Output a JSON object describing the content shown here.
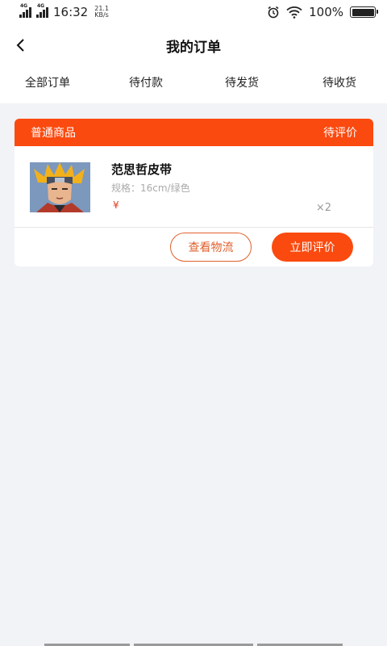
{
  "status_bar": {
    "network1": "4G",
    "network2": "4G",
    "time": "16:32",
    "speed_value": "21.1",
    "speed_unit": "KB/s",
    "battery": "100%"
  },
  "header": {
    "title": "我的订单"
  },
  "tabs": [
    "全部订单",
    "待付款",
    "待发货",
    "待收货"
  ],
  "order": {
    "category": "普通商品",
    "status": "待评价",
    "product_name": "范思哲皮带",
    "spec": "规格：16cm/绿色",
    "currency": "¥",
    "quantity": "×2",
    "actions": {
      "logistics": "查看物流",
      "review": "立即评价"
    }
  }
}
